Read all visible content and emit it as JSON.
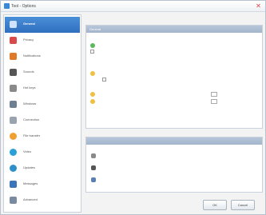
{
  "window": {
    "title": "Tool - Options"
  },
  "sidebar": {
    "items": [
      {
        "label": "General",
        "icon": "gear-icon",
        "color": "#3a7bd5"
      },
      {
        "label": "Privacy",
        "icon": "privacy-icon",
        "color": "#d94b4b"
      },
      {
        "label": "Notifications",
        "icon": "bell-icon",
        "color": "#e07a2b"
      },
      {
        "label": "Sounds",
        "icon": "speaker-icon",
        "color": "#555555"
      },
      {
        "label": "Hot keys",
        "icon": "keyboard-icon",
        "color": "#8a8a8a"
      },
      {
        "label": "Windows",
        "icon": "window-icon",
        "color": "#6f7f92"
      },
      {
        "label": "Connection",
        "icon": "plug-icon",
        "color": "#9aa4b0"
      },
      {
        "label": "File transfer",
        "icon": "file-transfer-icon",
        "color": "#f0a030"
      },
      {
        "label": "Video",
        "icon": "video-icon",
        "color": "#2aa0d8"
      },
      {
        "label": "Updates",
        "icon": "globe-icon",
        "color": "#2f8fc8"
      },
      {
        "label": "Messages",
        "icon": "message-icon",
        "color": "#3b74b8"
      },
      {
        "label": "Advanced",
        "icon": "advanced-icon",
        "color": "#7a8aa0"
      }
    ]
  },
  "general": {
    "header": "General",
    "intro": "",
    "option_1": "",
    "option_2": "",
    "option_3": "",
    "option_4": "",
    "option_5": "",
    "option_6": "",
    "option_7": "",
    "spin_5": "",
    "spin_6": ""
  },
  "section_2": {
    "header": "",
    "link_1": "",
    "link_2": "",
    "link_3": ""
  },
  "buttons": {
    "ok": "OK",
    "cancel": "Cancel"
  },
  "colors": {
    "accent": "#2f6fbf",
    "header": "#a3b5cc",
    "green": "#5cb85c",
    "yellow": "#f0c040"
  }
}
